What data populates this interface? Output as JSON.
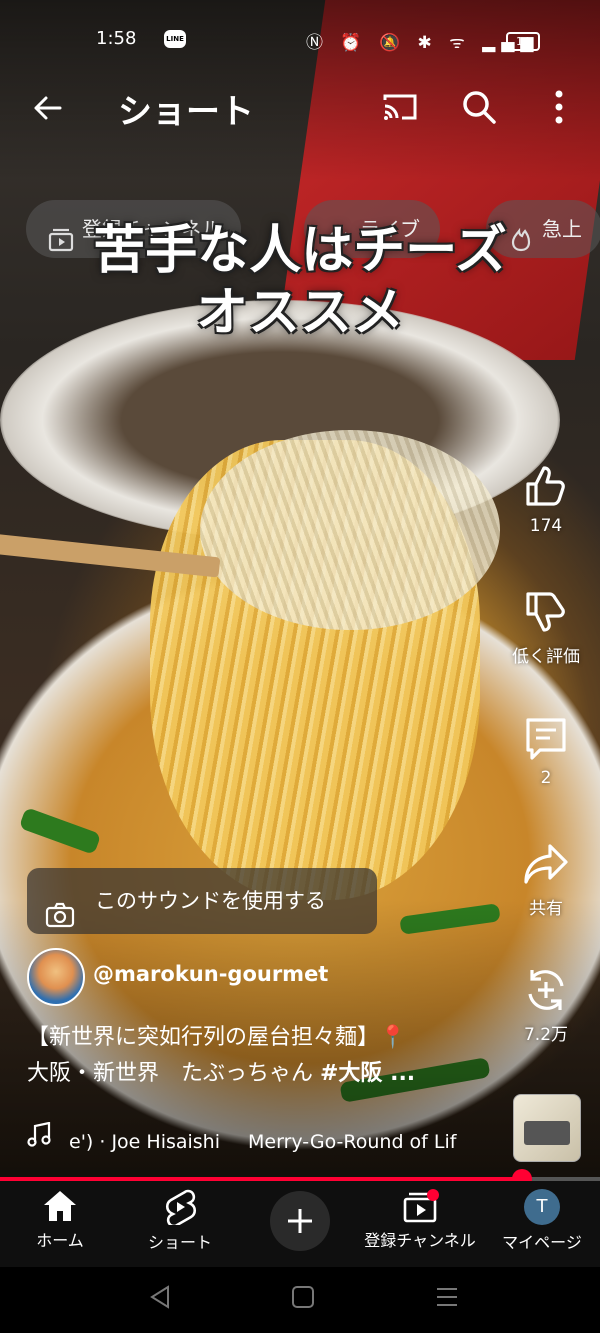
{
  "status_bar": {
    "time": "1:58",
    "line_badge": "LINE",
    "icons": "Ⓝ ⏰ 🔕 ✱ ᯤ ▂▄▆",
    "battery": "14"
  },
  "header": {
    "title": "ショート"
  },
  "chips": [
    {
      "label": "登録チャンネル",
      "icon": "subscriptions-icon"
    },
    {
      "label": "ライブ",
      "icon": "live-icon"
    },
    {
      "label": "急上",
      "icon": "trending-icon"
    }
  ],
  "video": {
    "overlay_text_line1": "苦手な人はチーズ",
    "overlay_text_line2": "オススメ"
  },
  "actions": {
    "like_count": "174",
    "dislike_label": "低く評価",
    "comment_count": "2",
    "share_label": "共有",
    "remix_count": "7.2万"
  },
  "sound_button": "このサウンドを使用する",
  "channel": {
    "handle": "@marokun-gourmet"
  },
  "description": {
    "line1": "【新世界に突如行列の屋台担々麺】📍",
    "line2_prefix": "大阪・新世界　たぶっちゃん ",
    "line2_hashtag": "#大阪 ..."
  },
  "music": {
    "artist": "e') · Joe Hisaishi",
    "track": "Merry-Go-Round of Lif"
  },
  "progress": {
    "fraction": 0.87
  },
  "bottom_nav": {
    "home": "ホーム",
    "shorts": "ショート",
    "subscriptions": "登録チャンネル",
    "mypage": "マイページ",
    "avatar_letter": "T"
  },
  "colors": {
    "accent_red": "#ff0033",
    "nav_bg": "#0f0f0f"
  }
}
